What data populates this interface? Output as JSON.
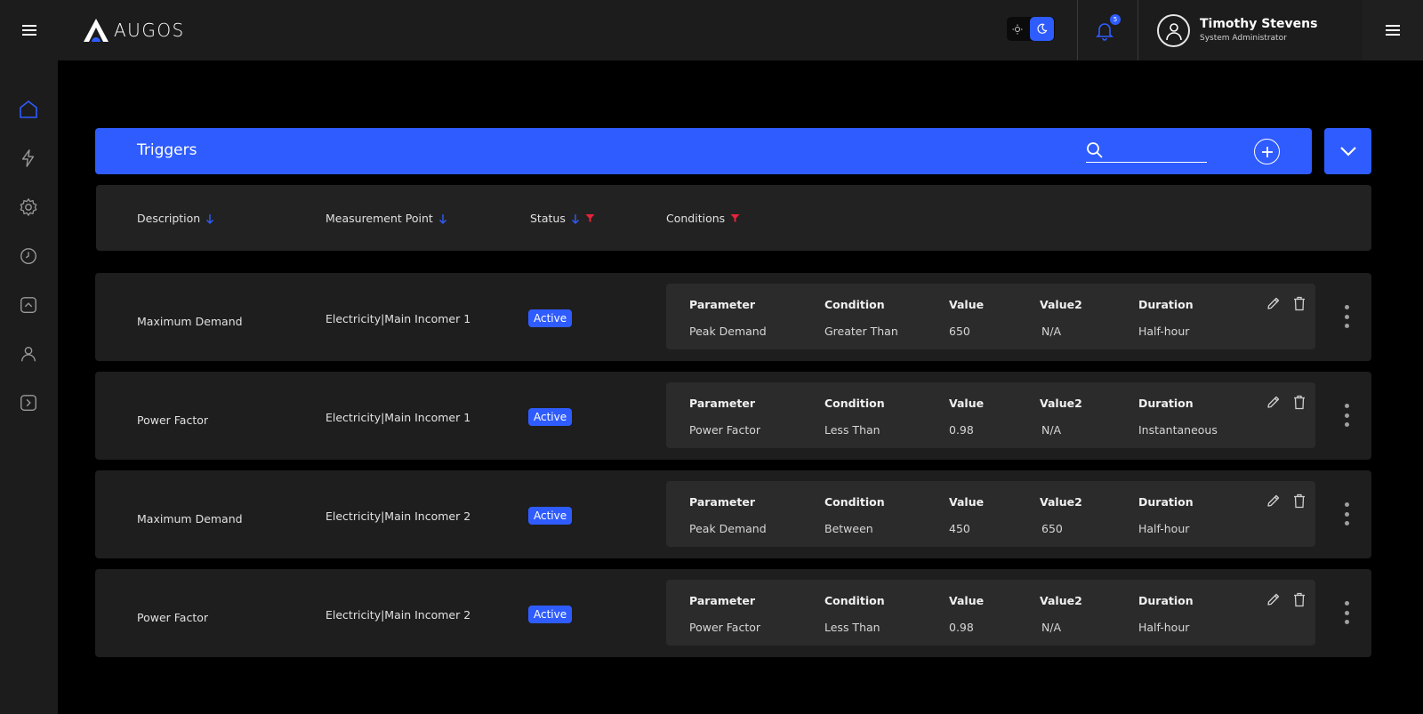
{
  "app": {
    "logo_text": "AUGOS"
  },
  "header": {
    "user_name": "Timothy Stevens",
    "user_role": "System Administrator",
    "notification_count": "5"
  },
  "sidebar": {
    "items": [
      {
        "icon": "home-icon"
      },
      {
        "icon": "lightning-icon"
      },
      {
        "icon": "gear-icon"
      },
      {
        "icon": "clock-icon"
      },
      {
        "icon": "chevron-up-box-icon"
      },
      {
        "icon": "user-icon"
      },
      {
        "icon": "chevron-right-box-icon"
      }
    ]
  },
  "panel": {
    "title": "Triggers",
    "search_placeholder": ""
  },
  "columns": {
    "description": "Description",
    "measurement_point": "Measurement Point",
    "status": "Status",
    "conditions": "Conditions"
  },
  "condition_headers": {
    "parameter": "Parameter",
    "condition": "Condition",
    "value": "Value",
    "value2": "Value2",
    "duration": "Duration"
  },
  "rows": [
    {
      "description": "Maximum Demand",
      "measurement_point": "Electricity|Main Incomer 1",
      "status": "Active",
      "parameter": "Peak Demand",
      "condition": "Greater Than",
      "value": "650",
      "value2": "N/A",
      "duration": "Half-hour"
    },
    {
      "description": "Power Factor",
      "measurement_point": "Electricity|Main Incomer 1",
      "status": "Active",
      "parameter": "Power Factor",
      "condition": "Less Than",
      "value": "0.98",
      "value2": "N/A",
      "duration": "Instantaneous"
    },
    {
      "description": "Maximum Demand",
      "measurement_point": "Electricity|Main Incomer 2",
      "status": "Active",
      "parameter": "Peak Demand",
      "condition": "Between",
      "value": "450",
      "value2": "650",
      "duration": "Half-hour"
    },
    {
      "description": "Power Factor",
      "measurement_point": "Electricity|Main Incomer 2",
      "status": "Active",
      "parameter": "Power Factor",
      "condition": "Less Than",
      "value": "0.98",
      "value2": "N/A",
      "duration": "Half-hour"
    }
  ],
  "colors": {
    "accent": "#2f5cff",
    "background": "#000000",
    "panel": "#1e1e1e",
    "sort_arrow": "#2f5cff",
    "filter_icon": "#e8233a"
  }
}
